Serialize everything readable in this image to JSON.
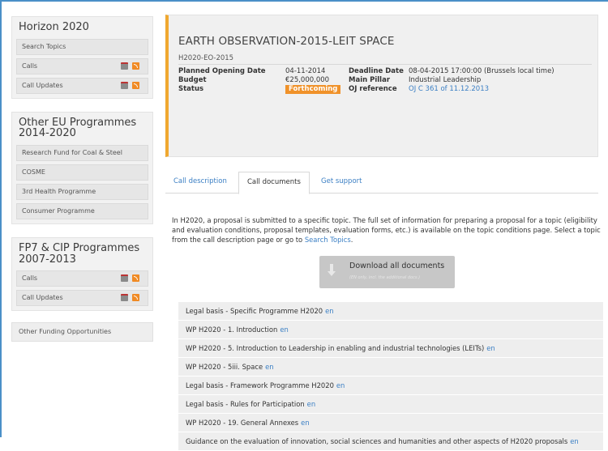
{
  "sidebar": {
    "horizon": {
      "title": "Horizon 2020",
      "items": [
        {
          "label": "Search Topics"
        },
        {
          "label": "Calls"
        },
        {
          "label": "Call Updates"
        }
      ]
    },
    "other_eu": {
      "title_line1": "Other EU Programmes",
      "title_line2": "2014-2020",
      "items": [
        {
          "label": "Research Fund for Coal & Steel"
        },
        {
          "label": "COSME"
        },
        {
          "label": "3rd Health Programme"
        },
        {
          "label": "Consumer Programme"
        }
      ]
    },
    "fp7": {
      "title_line1": "FP7 & CIP Programmes",
      "title_line2": "2007-2013",
      "items": [
        {
          "label": "Calls"
        },
        {
          "label": "Call Updates"
        }
      ]
    },
    "other_funding": {
      "label": "Other Funding Opportunities"
    }
  },
  "call": {
    "title": "EARTH OBSERVATION-2015-LEIT SPACE",
    "identifier": "H2020-EO-2015",
    "planned_opening_label": "Planned Opening Date",
    "planned_opening_value": "04-11-2014",
    "budget_label": "Budget",
    "budget_value": "€25,000,000",
    "status_label": "Status",
    "status_value": "Forthcoming",
    "deadline_label": "Deadline Date",
    "deadline_value": "08-04-2015 17:00:00 (Brussels local time)",
    "pillar_label": "Main Pillar",
    "pillar_value": "Industrial Leadership",
    "oj_label": "OJ reference",
    "oj_value": "OJ C 361 of 11.12.2013",
    "status_color": "#f0922a",
    "accent_color": "#f0a830"
  },
  "tabs": [
    {
      "label": "Call description"
    },
    {
      "label": "Call documents"
    },
    {
      "label": "Get support"
    }
  ],
  "intro": {
    "text": "In H2020, a proposal is submitted to a specific topic. The full set of information for preparing a proposal for a topic (eligibility and evaluation conditions, proposal templates, evaluation forms, etc.) is available on the topic conditions page. Select a topic from the call description page or go to ",
    "link": "Search Topics",
    "end": "."
  },
  "download": {
    "label": "Download all documents",
    "sub": "(EN only, incl. the additional docs.)"
  },
  "documents": [
    {
      "title": "Legal basis - Specific Programme H2020",
      "lang": "en"
    },
    {
      "title": "WP H2020 - 1. Introduction",
      "lang": "en"
    },
    {
      "title": "WP H2020 - 5. Introduction to Leadership in enabling and industrial technologies (LEITs)",
      "lang": "en"
    },
    {
      "title": "WP H2020 - 5iii. Space",
      "lang": "en"
    },
    {
      "title": "Legal basis - Framework Programme H2020",
      "lang": "en"
    },
    {
      "title": "Legal basis - Rules for Participation",
      "lang": "en"
    },
    {
      "title": "WP H2020 - 19. General Annexes",
      "lang": "en"
    },
    {
      "title": "Guidance on the evaluation of innovation, social sciences and humanities and other aspects of H2020 proposals",
      "lang": "en"
    }
  ]
}
